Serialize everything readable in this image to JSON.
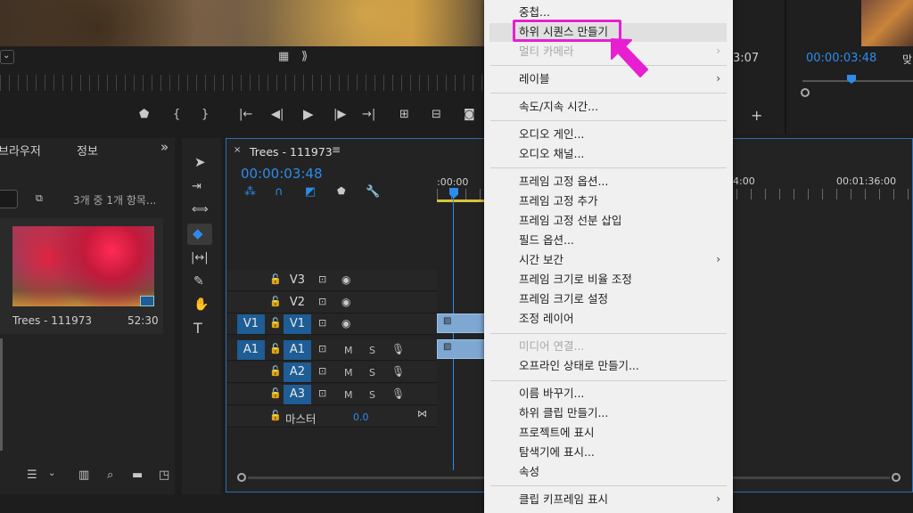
{
  "source_monitor": {
    "timecode_right": "3:07"
  },
  "program_monitor": {
    "timecode": "00:00:03:48",
    "extra_label": "맞"
  },
  "project_panel": {
    "tab_browser": "브라우저",
    "tab_info": "정보",
    "expand_glyph": "»",
    "item_count": "3개 중 1개 항목...",
    "clip_name": "Trees - 111973",
    "clip_duration": "52:30"
  },
  "timeline": {
    "sequence_title": "Trees - 111973",
    "timecode": "00:00:03:48",
    "ruler_labels": [
      ":00:00",
      "4:00",
      "00:01:36:00"
    ],
    "tracks": {
      "v3": "V3",
      "v2": "V2",
      "v1_src": "V1",
      "v1": "V1",
      "a1_src": "A1",
      "a1": "A1",
      "a2": "A2",
      "a3": "A3",
      "master_label": "마스터",
      "master_value": "0.0",
      "mute": "M",
      "solo": "S"
    }
  },
  "context_menu": {
    "items": [
      {
        "label": "중첩..."
      },
      {
        "label": "하위 시퀀스 만들기",
        "highlighted": true
      },
      {
        "label": "멀티 카메라",
        "disabled": true,
        "submenu": true
      },
      {
        "label": "레이블",
        "submenu": true
      },
      {
        "label": "속도/지속 시간..."
      },
      {
        "label": "오디오 게인..."
      },
      {
        "label": "오디오 채널..."
      },
      {
        "label": "프레임 고정 옵션..."
      },
      {
        "label": "프레임 고정 추가"
      },
      {
        "label": "프레임 고정 선분 삽입"
      },
      {
        "label": "필드 옵션..."
      },
      {
        "label": "시간 보간",
        "submenu": true
      },
      {
        "label": "프레임 크기로 비율 조정"
      },
      {
        "label": "프레임 크기로 설정"
      },
      {
        "label": "조정 레이어"
      },
      {
        "label": "미디어 연결...",
        "disabled": true
      },
      {
        "label": "오프라인 상태로 만들기..."
      },
      {
        "label": "이름 바꾸기..."
      },
      {
        "label": "하위 클립 만들기..."
      },
      {
        "label": "프로젝트에 표시"
      },
      {
        "label": "탐색기에 표시..."
      },
      {
        "label": "속성"
      },
      {
        "label": "클립 키프레임 표시",
        "submenu": true
      }
    ],
    "submenu_glyph": "›"
  },
  "colors": {
    "accent_blue": "#2d8ceb",
    "highlight_magenta": "#e81fd1",
    "target_blue": "#1e5d95"
  }
}
